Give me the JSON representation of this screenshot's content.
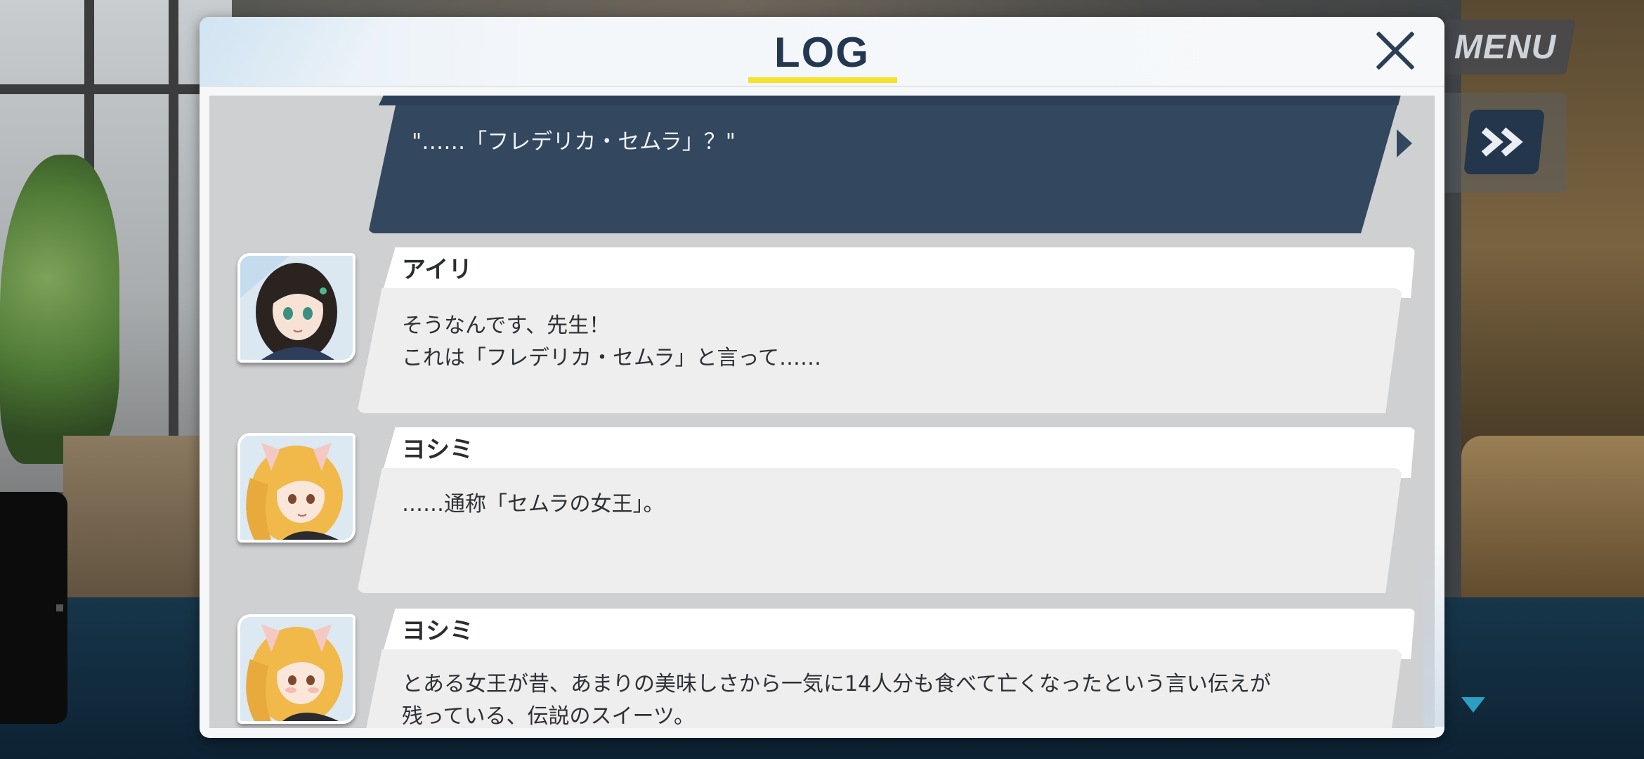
{
  "hud": {
    "menu_label": "MENU",
    "fast_forward_icon": "fast-forward-icon",
    "scroll_down_icon": "scroll-down-icon"
  },
  "log": {
    "title": "LOG",
    "close_icon": "close-icon",
    "player_line": "\"……「フレデリカ・セムラ」？\"",
    "entries": [
      {
        "name": "アイリ",
        "avatar": "airi-portrait",
        "lines": [
          "そうなんです、先生！",
          "これは「フレデリカ・セムラ」と言って……"
        ]
      },
      {
        "name": "ヨシミ",
        "avatar": "yoshimi-portrait",
        "lines": [
          "……通称「セムラの女王」。"
        ]
      },
      {
        "name": "ヨシミ",
        "avatar": "yoshimi-portrait",
        "lines": [
          "とある女王が昔、あまりの美味しさから一気に14人分も食べて亡くなったという言い伝えが",
          "残っている、伝説のスイーツ。"
        ]
      }
    ]
  },
  "colors": {
    "accent_yellow": "#f4e22c",
    "player_bubble": "#33475f",
    "title_navy": "#233850"
  }
}
